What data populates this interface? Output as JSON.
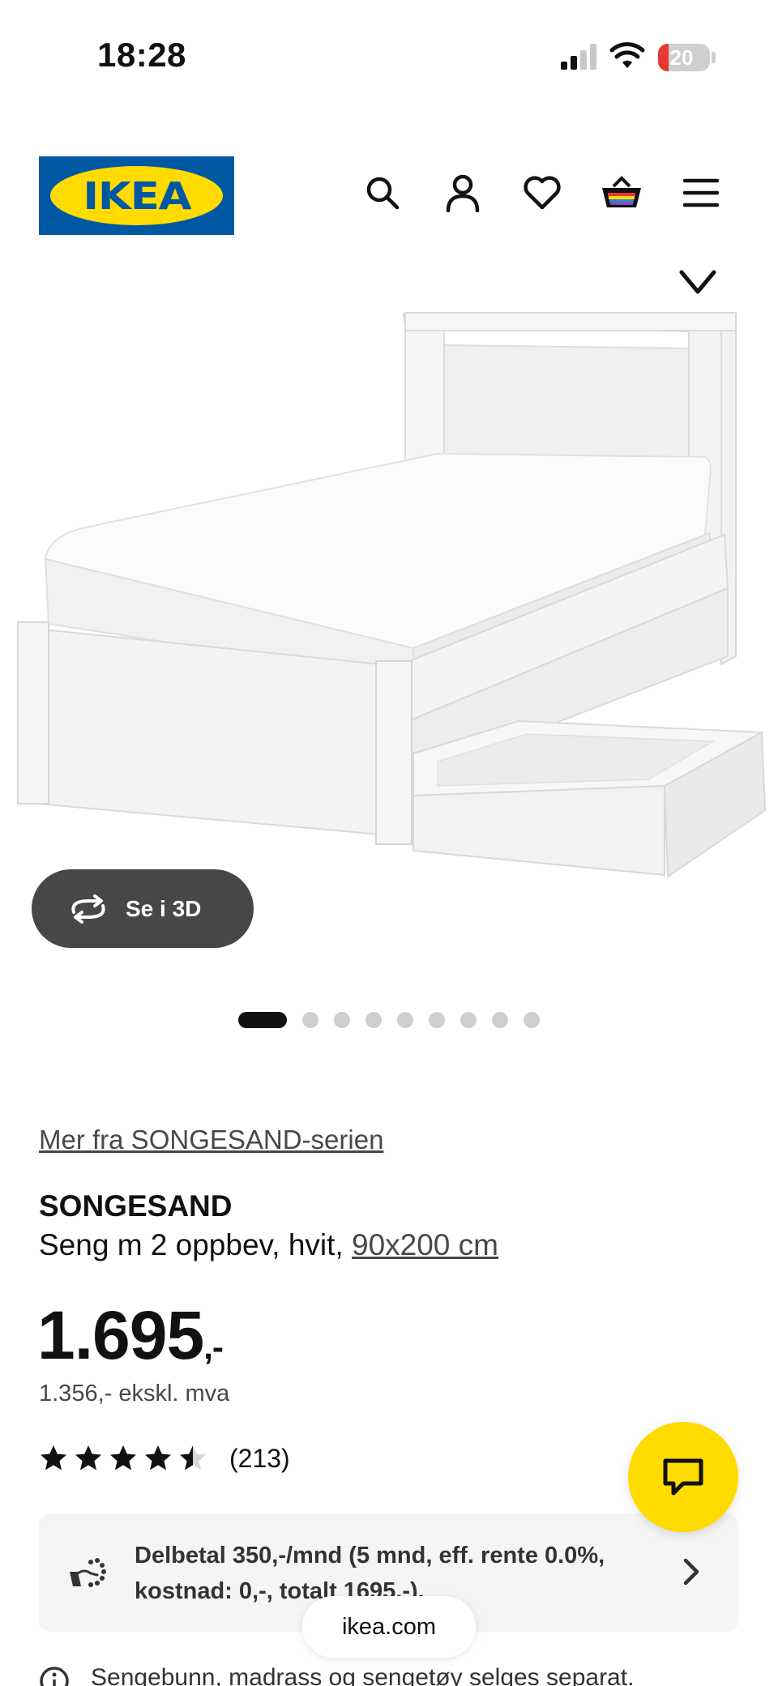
{
  "status_bar": {
    "time": "18:28",
    "battery_level": "20",
    "battery_color": "#e5392f"
  },
  "header": {
    "logo_text": "IKEA",
    "icons": [
      "search-icon",
      "user-icon",
      "heart-icon",
      "basket-icon",
      "menu-icon"
    ]
  },
  "gallery": {
    "see_3d_label": "Se i 3D",
    "image_count": 9,
    "active_index": 0
  },
  "product": {
    "series_link": "Mer fra SONGESAND-serien",
    "name": "SONGESAND",
    "description": "Seng m 2 oppbev, hvit, ",
    "size_link": "90x200 cm",
    "price": "1.695",
    "price_suffix": ",-",
    "price_ex_vat": "1.356,- ekskl. mva",
    "rating_value": 4.5,
    "rating_max": 5,
    "rating_count": "(213)"
  },
  "finance": {
    "text": "Delbetal 350,-/mnd (5 mnd, eff. rente 0.0%, kostnad: 0,-, totalt 1695,-)."
  },
  "browser": {
    "url": "ikea.com"
  },
  "note": {
    "text": "Sengebunn, madrass og sengetøy selges separat."
  },
  "colors": {
    "ikea_blue": "#0058a3",
    "ikea_yellow": "#ffdb00",
    "pill_dark": "#474747"
  }
}
